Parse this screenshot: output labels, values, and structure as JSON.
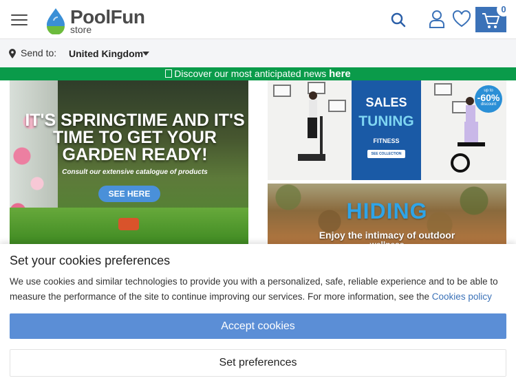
{
  "header": {
    "logo_text": "PoolFun",
    "logo_subtext": "store",
    "cart_count": "0",
    "icons": [
      "menu-icon",
      "search-icon",
      "user-icon",
      "heart-icon",
      "cart-icon"
    ],
    "accent_color": "#3b72b8"
  },
  "sendbar": {
    "label": "Send to:",
    "country": "United Kingdom"
  },
  "announcement": {
    "text": "Discover our most anticipated news ",
    "link": "here",
    "background": "#0a9b4a"
  },
  "banners": {
    "spring": {
      "title": "IT'S SPRINGTIME AND IT'S TIME TO GET YOUR GARDEN READY!",
      "subtitle": "Consult our extensive catalogue of products",
      "cta": "SEE HERE"
    },
    "sales": {
      "line1": "SALES",
      "line2": "TUNING",
      "line3": "FITNESS",
      "cta": "SEE COLLECTION",
      "discount_upto": "up to",
      "discount": "-60%",
      "discount_label": "discount"
    },
    "hiding": {
      "title": "HIDING",
      "subtitle": "Enjoy the intimacy of outdoor",
      "subtitle2": "wellness"
    }
  },
  "cookies": {
    "title": "Set your cookies preferences",
    "text": "We use cookies and similar technologies to provide you with a personalized, safe, reliable experience and to be able to measure the performance of the site to continue improving our services. For more information, see the ",
    "policy_link": "Cookies policy",
    "accept": "Accept cookies",
    "preferences": "Set preferences"
  }
}
